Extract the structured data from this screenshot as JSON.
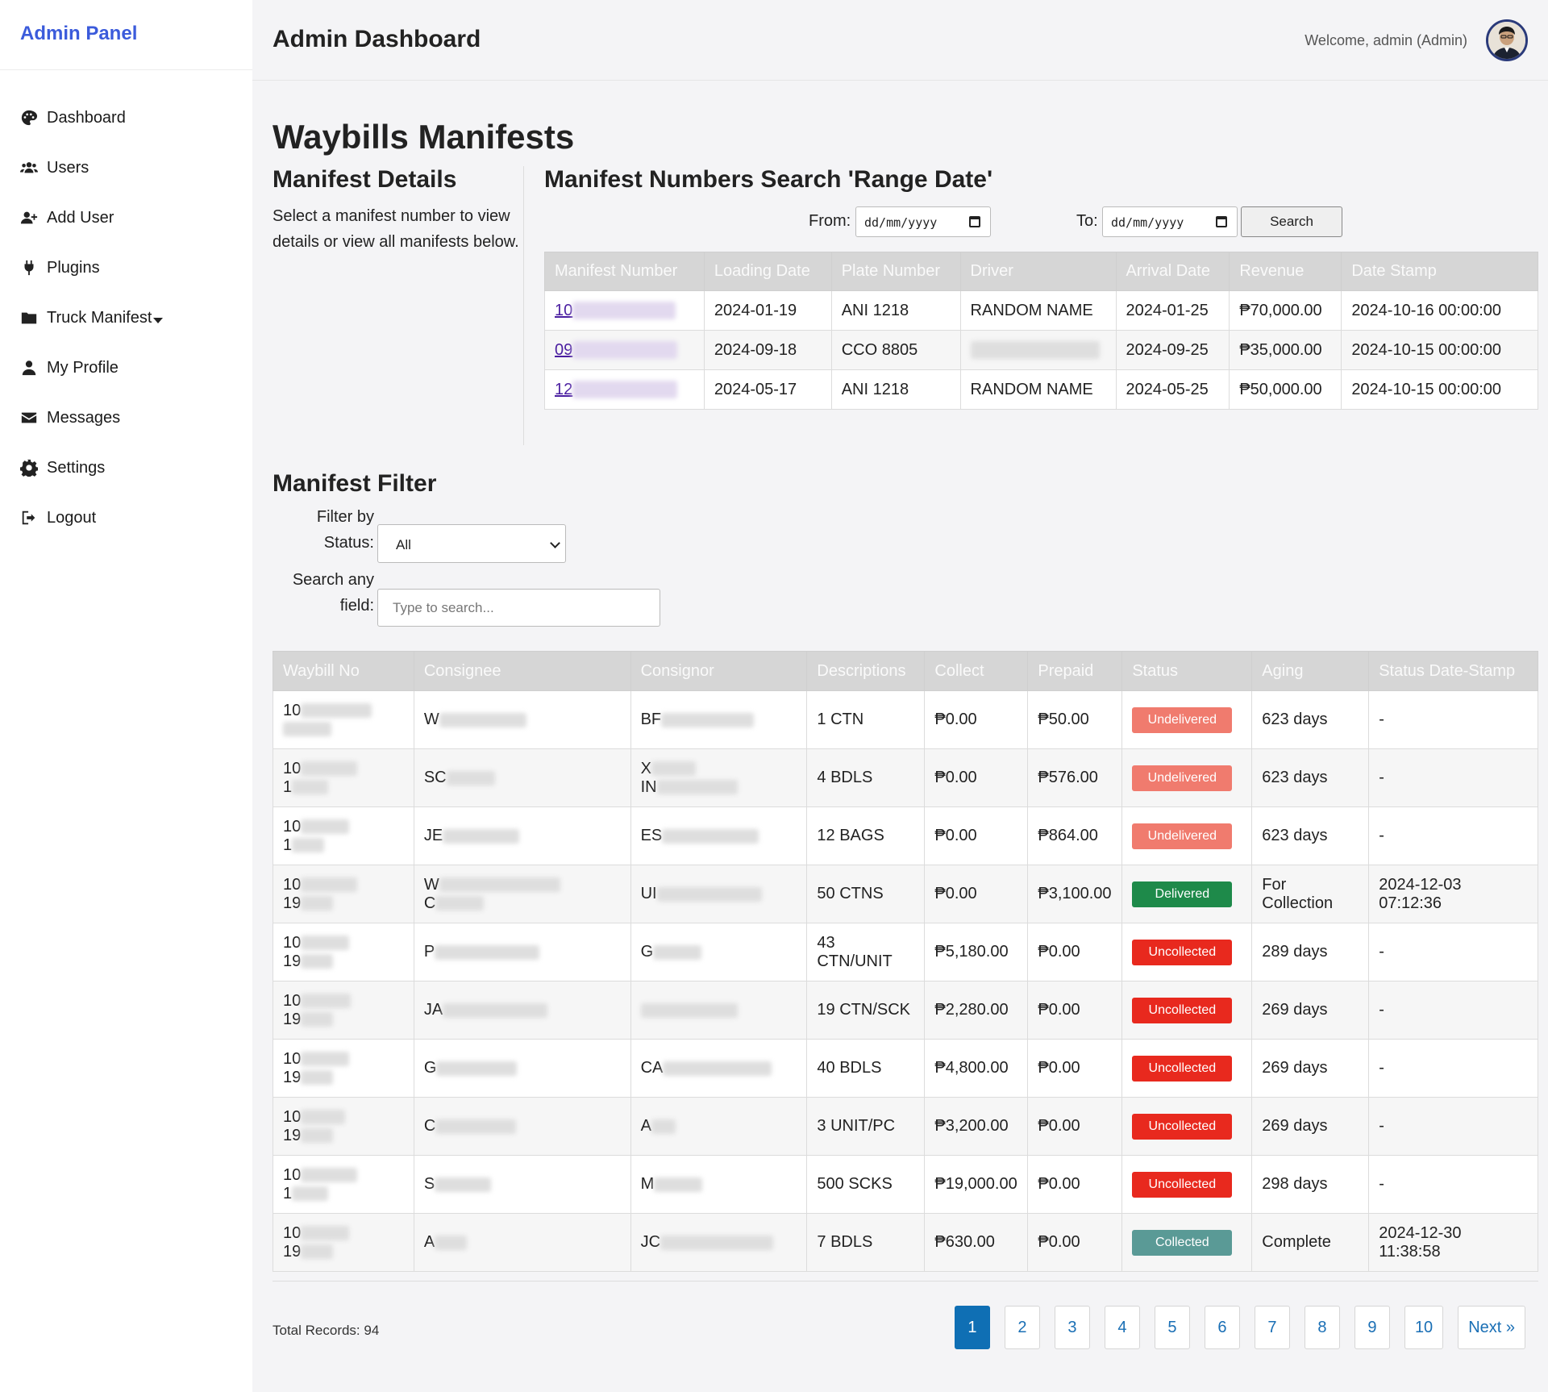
{
  "sidebar": {
    "brand": "Admin Panel",
    "items": [
      {
        "label": "Dashboard",
        "icon": "palette-icon"
      },
      {
        "label": "Users",
        "icon": "users-icon"
      },
      {
        "label": "Add User",
        "icon": "add-user-icon"
      },
      {
        "label": "Plugins",
        "icon": "plug-icon"
      },
      {
        "label": "Truck Manifest",
        "icon": "folder-icon"
      },
      {
        "label": "My Profile",
        "icon": "user-icon"
      },
      {
        "label": "Messages",
        "icon": "envelope-icon"
      },
      {
        "label": "Settings",
        "icon": "gear-icon"
      },
      {
        "label": "Logout",
        "icon": "logout-icon"
      }
    ]
  },
  "header": {
    "title": "Admin Dashboard",
    "welcome": "Welcome, admin (Admin)"
  },
  "page": {
    "title": "Waybills Manifests"
  },
  "details": {
    "title": "Manifest Details",
    "description": "Select a manifest number to view details or view all manifests below."
  },
  "range_search": {
    "title": "Manifest Numbers Search 'Range Date'",
    "from_label": "From:",
    "to_label": "To:",
    "date_placeholder": "dd/mm/yyyy",
    "button": "Search"
  },
  "manifest_table": {
    "headers": [
      "Manifest Number",
      "Loading Date",
      "Plate Number",
      "Driver",
      "Arrival Date",
      "Revenue",
      "Date Stamp"
    ],
    "rows": [
      {
        "number": "10",
        "loading": "2024-01-19",
        "plate": "ANI 1218",
        "driver": "RANDOM NAME",
        "arrival": "2024-01-25",
        "revenue": "₱70,000.00",
        "stamp": "2024-10-16 00:00:00"
      },
      {
        "number": "09",
        "loading": "2024-09-18",
        "plate": "CCO 8805",
        "driver": "",
        "arrival": "2024-09-25",
        "revenue": "₱35,000.00",
        "stamp": "2024-10-15 00:00:00"
      },
      {
        "number": "12",
        "loading": "2024-05-17",
        "plate": "ANI 1218",
        "driver": "RANDOM NAME",
        "arrival": "2024-05-25",
        "revenue": "₱50,000.00",
        "stamp": "2024-10-15 00:00:00"
      }
    ]
  },
  "filter": {
    "title": "Manifest Filter",
    "status_label_1": "Filter by",
    "status_label_2": "Status:",
    "status_value": "All",
    "search_label_1": "Search any",
    "search_label_2": "field:",
    "search_placeholder": "Type to search..."
  },
  "waybill_table": {
    "headers": [
      "Waybill No",
      "Consignee",
      "Consignor",
      "Descriptions",
      "Collect",
      "Prepaid",
      "Status",
      "Aging",
      "Status Date-Stamp"
    ],
    "rows": [
      {
        "wb1": "10",
        "wb2": "",
        "consignee1": "W",
        "consignee2": "",
        "consignor1": "BF",
        "consignor2": "",
        "desc1": "1 CTN",
        "desc2": "",
        "collect": "₱0.00",
        "prepaid": "₱50.00",
        "status": "Undelivered",
        "aging1": "623 days",
        "aging2": "",
        "stamp1": "-",
        "stamp2": ""
      },
      {
        "wb1": "10",
        "wb2": "1",
        "consignee1": "SC",
        "consignee2": "",
        "consignor1": "X",
        "consignor2": "IN",
        "desc1": "4 BDLS",
        "desc2": "",
        "collect": "₱0.00",
        "prepaid": "₱576.00",
        "status": "Undelivered",
        "aging1": "623 days",
        "aging2": "",
        "stamp1": "-",
        "stamp2": ""
      },
      {
        "wb1": "10",
        "wb2": "1",
        "consignee1": "JE",
        "consignee2": "",
        "consignor1": "ES",
        "consignor2": "",
        "desc1": "12 BAGS",
        "desc2": "",
        "collect": "₱0.00",
        "prepaid": "₱864.00",
        "status": "Undelivered",
        "aging1": "623 days",
        "aging2": "",
        "stamp1": "-",
        "stamp2": ""
      },
      {
        "wb1": "10",
        "wb2": "19",
        "consignee1": "W",
        "consignee2": "C",
        "consignor1": "UI",
        "consignor2": "",
        "desc1": "50 CTNS",
        "desc2": "",
        "collect": "₱0.00",
        "prepaid": "₱3,100.00",
        "status": "Delivered",
        "aging1": "For",
        "aging2": "Collection",
        "stamp1": "2024-12-03",
        "stamp2": "07:12:36"
      },
      {
        "wb1": "10",
        "wb2": "19",
        "consignee1": "P",
        "consignee2": "",
        "consignor1": "G",
        "consignor2": "",
        "desc1": "43",
        "desc2": "CTN/UNIT",
        "collect": "₱5,180.00",
        "prepaid": "₱0.00",
        "status": "Uncollected",
        "aging1": "289 days",
        "aging2": "",
        "stamp1": "-",
        "stamp2": ""
      },
      {
        "wb1": "10",
        "wb2": "19",
        "consignee1": "JA",
        "consignee2": "",
        "consignor1": "",
        "consignor2": "",
        "desc1": "19 CTN/SCK",
        "desc2": "",
        "collect": "₱2,280.00",
        "prepaid": "₱0.00",
        "status": "Uncollected",
        "aging1": "269 days",
        "aging2": "",
        "stamp1": "-",
        "stamp2": ""
      },
      {
        "wb1": "10",
        "wb2": "19",
        "consignee1": "G",
        "consignee2": "",
        "consignor1": "CA",
        "consignor2": "",
        "desc1": "40 BDLS",
        "desc2": "",
        "collect": "₱4,800.00",
        "prepaid": "₱0.00",
        "status": "Uncollected",
        "aging1": "269 days",
        "aging2": "",
        "stamp1": "-",
        "stamp2": ""
      },
      {
        "wb1": "10",
        "wb2": "19",
        "consignee1": "C",
        "consignee2": "",
        "consignor1": "A",
        "consignor2": "",
        "desc1": "3 UNIT/PC",
        "desc2": "",
        "collect": "₱3,200.00",
        "prepaid": "₱0.00",
        "status": "Uncollected",
        "aging1": "269 days",
        "aging2": "",
        "stamp1": "-",
        "stamp2": ""
      },
      {
        "wb1": "10",
        "wb2": "1",
        "consignee1": "S",
        "consignee2": "",
        "consignor1": "M",
        "consignor2": "",
        "desc1": "500 SCKS",
        "desc2": "",
        "collect": "₱19,000.00",
        "prepaid": "₱0.00",
        "status": "Uncollected",
        "aging1": "298 days",
        "aging2": "",
        "stamp1": "-",
        "stamp2": ""
      },
      {
        "wb1": "10",
        "wb2": "19",
        "consignee1": "A",
        "consignee2": "",
        "consignor1": "JC",
        "consignor2": "",
        "desc1": "7 BDLS",
        "desc2": "",
        "collect": "₱630.00",
        "prepaid": "₱0.00",
        "status": "Collected",
        "aging1": "Complete",
        "aging2": "",
        "stamp1": "2024-12-30",
        "stamp2": "11:38:58"
      }
    ]
  },
  "footer": {
    "total": "Total Records: 94",
    "pages": [
      "1",
      "2",
      "3",
      "4",
      "5",
      "6",
      "7",
      "8",
      "9",
      "10"
    ],
    "next": "Next »"
  },
  "colors": {
    "brand": "#3b5bdb",
    "undelivered": "#f07b6e",
    "delivered": "#1e8a4a",
    "uncollected": "#e8291e",
    "collected": "#5a9a96",
    "pager_active": "#0f6fb4"
  }
}
